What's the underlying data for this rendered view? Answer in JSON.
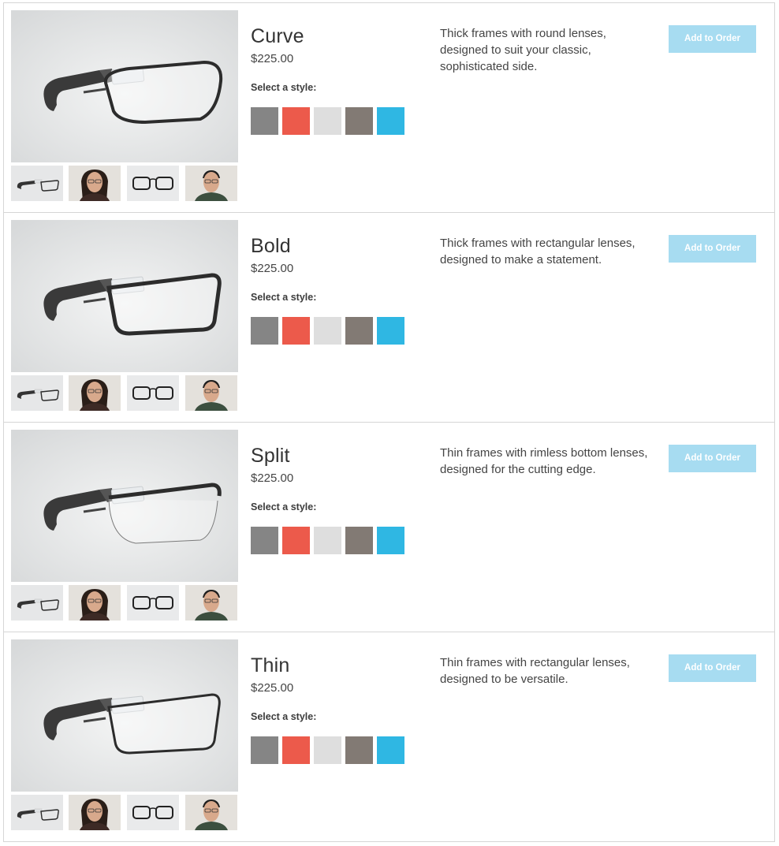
{
  "products": [
    {
      "name": "Curve",
      "price": "$225.00",
      "select_label": "Select a style:",
      "description": "Thick frames with round lenses, designed to suit your classic, sophisticated side.",
      "button_label": "Add to Order",
      "lens_shape": "round"
    },
    {
      "name": "Bold",
      "price": "$225.00",
      "select_label": "Select a style:",
      "description": "Thick frames with rectangular lenses, designed to make a statement.",
      "button_label": "Add to Order",
      "lens_shape": "rect-thick"
    },
    {
      "name": "Split",
      "price": "$225.00",
      "select_label": "Select a style:",
      "description": "Thin frames with rimless bottom lenses, designed for the cutting edge.",
      "button_label": "Add to Order",
      "lens_shape": "split"
    },
    {
      "name": "Thin",
      "price": "$225.00",
      "select_label": "Select a style:",
      "description": "Thin frames with rectangular lenses, designed to be versatile.",
      "button_label": "Add to Order",
      "lens_shape": "rect-thin"
    }
  ],
  "style_swatches": [
    {
      "name": "charcoal",
      "color": "#858585"
    },
    {
      "name": "tangerine",
      "color": "#ec5a4b"
    },
    {
      "name": "cotton",
      "color": "#dedede"
    },
    {
      "name": "shale",
      "color": "#827a74"
    },
    {
      "name": "sky",
      "color": "#2fb7e3"
    }
  ],
  "thumbnails": [
    "glasses-side-thumb",
    "model-woman-thumb",
    "glasses-front-thumb",
    "model-man-thumb"
  ],
  "colors": {
    "button_bg": "#a7dcf1",
    "border": "#d6d6d6"
  }
}
